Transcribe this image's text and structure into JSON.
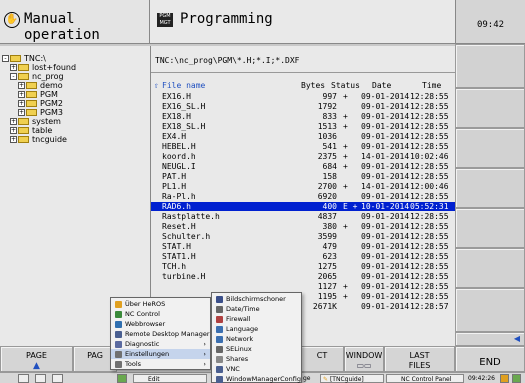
{
  "header": {
    "mode": "Manual operation",
    "pgm_badge": "PGM MGT",
    "program": "Programming",
    "clock": "09:42"
  },
  "tree": [
    {
      "label": "TNC:\\",
      "exp": "-",
      "level": 0
    },
    {
      "label": "lost+found",
      "exp": "+",
      "level": 1
    },
    {
      "label": "nc_prog",
      "exp": "-",
      "level": 1
    },
    {
      "label": "demo",
      "exp": "+",
      "level": 2
    },
    {
      "label": "PGM",
      "exp": "+",
      "level": 2
    },
    {
      "label": "PGM2",
      "exp": "+",
      "level": 2
    },
    {
      "label": "PGM3",
      "exp": "+",
      "level": 2
    },
    {
      "label": "system",
      "exp": "+",
      "level": 1
    },
    {
      "label": "table",
      "exp": "+",
      "level": 1
    },
    {
      "label": "tncguide",
      "exp": "+",
      "level": 1
    }
  ],
  "files": {
    "path": "TNC:\\nc_prog\\PGM\\*.H;*.I;*.DXF",
    "headers": {
      "name": "File name",
      "bytes": "Bytes",
      "status": "Status",
      "date": "Date",
      "time": "Time"
    },
    "rows": [
      {
        "name": "EX16.H",
        "bytes": "997",
        "status": "+",
        "date": "09-01-2014",
        "time": "12:28:55"
      },
      {
        "name": "EX16_SL.H",
        "bytes": "1792",
        "status": "",
        "date": "09-01-2014",
        "time": "12:28:55"
      },
      {
        "name": "EX18.H",
        "bytes": "833",
        "status": "+",
        "date": "09-01-2014",
        "time": "12:28:55"
      },
      {
        "name": "EX18_SL.H",
        "bytes": "1513",
        "status": "+",
        "date": "09-01-2014",
        "time": "12:28:55"
      },
      {
        "name": "EX4.H",
        "bytes": "1036",
        "status": "",
        "date": "09-01-2014",
        "time": "12:28:55"
      },
      {
        "name": "HEBEL.H",
        "bytes": "541",
        "status": "+",
        "date": "09-01-2014",
        "time": "12:28:55"
      },
      {
        "name": "koord.h",
        "bytes": "2375",
        "status": "+",
        "date": "14-01-2014",
        "time": "10:02:46"
      },
      {
        "name": "NEUGL.I",
        "bytes": "684",
        "status": "+",
        "date": "09-01-2014",
        "time": "12:28:55"
      },
      {
        "name": "PAT.H",
        "bytes": "158",
        "status": "",
        "date": "09-01-2014",
        "time": "12:28:55"
      },
      {
        "name": "PL1.H",
        "bytes": "2700",
        "status": "+",
        "date": "14-01-2014",
        "time": "12:00:46"
      },
      {
        "name": "Ra-Pl.h",
        "bytes": "6920",
        "status": "",
        "date": "09-01-2014",
        "time": "12:28:55"
      },
      {
        "name": "RAD6.h",
        "bytes": "400",
        "status": "E  +",
        "date": "10-01-2014",
        "time": "05:52:31",
        "selected": true
      },
      {
        "name": "Rastplatte.h",
        "bytes": "4837",
        "status": "",
        "date": "09-01-2014",
        "time": "12:28:55"
      },
      {
        "name": "Reset.H",
        "bytes": "380",
        "status": "+",
        "date": "09-01-2014",
        "time": "12:28:55"
      },
      {
        "name": "Schulter.h",
        "bytes": "3599",
        "status": "",
        "date": "09-01-2014",
        "time": "12:28:55"
      },
      {
        "name": "STAT.H",
        "bytes": "479",
        "status": "",
        "date": "09-01-2014",
        "time": "12:28:55"
      },
      {
        "name": "STAT1.H",
        "bytes": "623",
        "status": "",
        "date": "09-01-2014",
        "time": "12:28:55"
      },
      {
        "name": "TCH.h",
        "bytes": "1275",
        "status": "",
        "date": "09-01-2014",
        "time": "12:28:55"
      },
      {
        "name": "turbine.H",
        "bytes": "2065",
        "status": "",
        "date": "09-01-2014",
        "time": "12:28:55"
      },
      {
        "name": "",
        "bytes": "1127",
        "status": "+",
        "date": "09-01-2014",
        "time": "12:28:55"
      },
      {
        "name": "",
        "bytes": "1195",
        "status": "+",
        "date": "09-01-2014",
        "time": "12:28:55"
      },
      {
        "name": "",
        "bytes": "2671K",
        "status": "",
        "date": "09-01-2014",
        "time": "12:28:57"
      }
    ]
  },
  "menu_main": [
    {
      "label": "Über HeROS",
      "icon": "star-icon",
      "color": "#e0a020",
      "arrow": false
    },
    {
      "label": "NC Control",
      "icon": "nc-control-icon",
      "color": "#3a8a3a",
      "arrow": false
    },
    {
      "label": "Webbrowser",
      "icon": "globe-icon",
      "color": "#2f6fb0",
      "arrow": false
    },
    {
      "label": "Remote Desktop Manager",
      "icon": "monitor-icon",
      "color": "#4a5f90",
      "arrow": false
    },
    {
      "label": "Diagnostic",
      "icon": "diagnostic-icon",
      "color": "#5a6aa0",
      "arrow": true
    },
    {
      "label": "Einstellungen",
      "icon": "settings-icon",
      "color": "#707070",
      "arrow": true,
      "highlight": true
    },
    {
      "label": "Tools",
      "icon": "tools-icon",
      "color": "#707070",
      "arrow": true
    }
  ],
  "menu_sub": [
    {
      "label": "Bildschirmschoner",
      "icon": "screensaver-icon",
      "color": "#3b4f8a"
    },
    {
      "label": "Date/Time",
      "icon": "clock-icon",
      "color": "#666666"
    },
    {
      "label": "Firewall",
      "icon": "firewall-icon",
      "color": "#b04040"
    },
    {
      "label": "Language",
      "icon": "language-icon",
      "color": "#3b6fb0"
    },
    {
      "label": "Network",
      "icon": "network-icon",
      "color": "#3b6fb0"
    },
    {
      "label": "SELinux",
      "icon": "selinux-icon",
      "color": "#666666"
    },
    {
      "label": "Shares",
      "icon": "shares-icon",
      "color": "#888888"
    },
    {
      "label": "VNC",
      "icon": "vnc-icon",
      "color": "#4a5f90"
    },
    {
      "label": "WindowManagerConfig",
      "icon": "window-manager-icon",
      "color": "#4a5f90"
    }
  ],
  "bottom_keys": {
    "page1": "PAGE",
    "page2": "PAG",
    "ct": "CT",
    "window": "WINDOW",
    "last_1": "LAST",
    "last_2": "FILES",
    "end": "END"
  },
  "taskbar": {
    "edit": "Edit",
    "ge": "ge",
    "tncguide": "[TNCguide]",
    "ncpanel": "NC Control Panel",
    "time": "09:42:26"
  }
}
